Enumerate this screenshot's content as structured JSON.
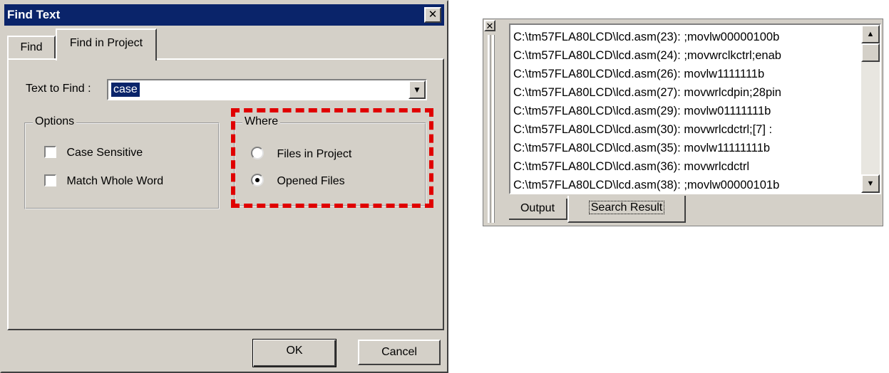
{
  "dialog": {
    "title": "Find Text",
    "close_glyph": "✕",
    "tabs": [
      {
        "label": "Find"
      },
      {
        "label": "Find in Project"
      }
    ],
    "text_to_find": {
      "label": "Text to Find :",
      "value": "case"
    },
    "options": {
      "legend": "Options",
      "items": [
        {
          "label": "Case Sensitive",
          "checked": false
        },
        {
          "label": "Match Whole Word",
          "checked": false
        }
      ]
    },
    "where": {
      "legend": "Where",
      "items": [
        {
          "label": "Files in Project",
          "selected": false
        },
        {
          "label": "Opened Files",
          "selected": true
        }
      ]
    },
    "ok_label": "OK",
    "cancel_label": "Cancel"
  },
  "output_panel": {
    "close_glyph": "✕",
    "results": [
      "C:\\tm57FLA80LCD\\lcd.asm(23): ;movlw00000100b",
      "C:\\tm57FLA80LCD\\lcd.asm(24): ;movwrclkctrl;enab",
      "C:\\tm57FLA80LCD\\lcd.asm(26): movlw1111111b",
      "C:\\tm57FLA80LCD\\lcd.asm(27): movwrlcdpin;28pin",
      "C:\\tm57FLA80LCD\\lcd.asm(29): movlw01111111b",
      "C:\\tm57FLA80LCD\\lcd.asm(30): movwrlcdctrl;[7] :",
      "C:\\tm57FLA80LCD\\lcd.asm(35): movlw11111111b",
      "C:\\tm57FLA80LCD\\lcd.asm(36): movwrlcdctrl",
      "C:\\tm57FLA80LCD\\lcd.asm(38): ;movlw00000101b"
    ],
    "tabs": [
      {
        "label": "Output"
      },
      {
        "label": "Search Result"
      }
    ]
  },
  "colors": {
    "titlebar": "#0a246a",
    "face": "#d4d0c8",
    "highlight_border": "#e00000"
  }
}
